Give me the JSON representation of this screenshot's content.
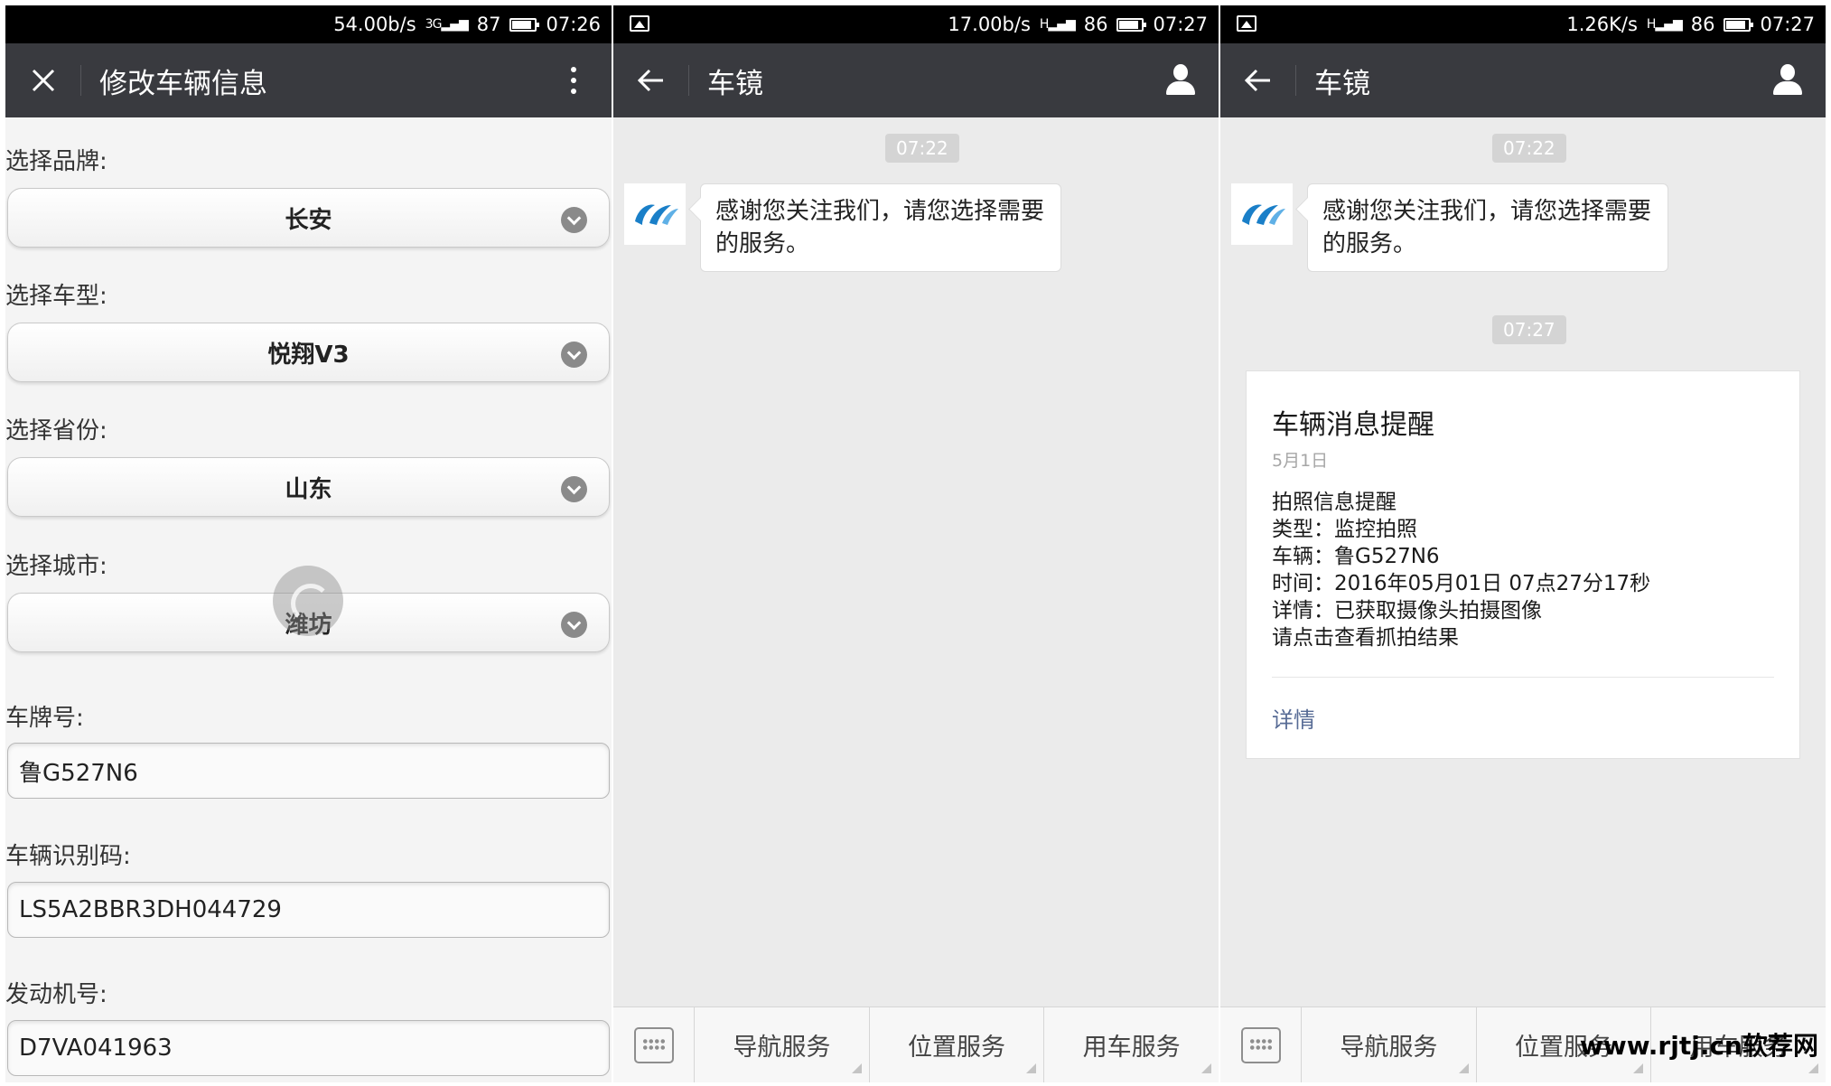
{
  "panel1": {
    "status": {
      "speed": "54.00b/s",
      "network": "3G",
      "battery": "87",
      "time": "07:26"
    },
    "nav": {
      "title": "修改车辆信息"
    },
    "form": {
      "brand": {
        "label": "选择品牌:",
        "value": "长安"
      },
      "model": {
        "label": "选择车型:",
        "value": "悦翔V3"
      },
      "province": {
        "label": "选择省份:",
        "value": "山东"
      },
      "city": {
        "label": "选择城市:",
        "value": "潍坊"
      },
      "plate": {
        "label": "车牌号:",
        "value": "鲁G527N6"
      },
      "vin": {
        "label": "车辆识别码:",
        "value": "LS5A2BBR3DH044729"
      },
      "engine": {
        "label": "发动机号:",
        "value": "D7VA041963"
      }
    }
  },
  "panel2": {
    "status": {
      "speed": "17.00b/s",
      "network": "H",
      "battery": "86",
      "time": "07:27"
    },
    "nav": {
      "title": "车镜"
    },
    "chat": {
      "time1": "07:22",
      "message": "感谢您关注我们，请您选择需要的服务。"
    },
    "menu": [
      "导航服务",
      "位置服务",
      "用车服务"
    ]
  },
  "panel3": {
    "status": {
      "speed": "1.26K/s",
      "network": "H",
      "battery": "86",
      "time": "07:27"
    },
    "nav": {
      "title": "车镜"
    },
    "chat": {
      "time1": "07:22",
      "message": "感谢您关注我们，请您选择需要的服务。",
      "time2": "07:27"
    },
    "card": {
      "title": "车辆消息提醒",
      "date": "5月1日",
      "lines": [
        "拍照信息提醒",
        "类型：监控拍照",
        "车辆：鲁G527N6",
        "时间：2016年05月01日 07点27分17秒",
        "详情：已获取摄像头拍摄图像",
        "请点击查看抓拍结果"
      ],
      "link": "详情"
    },
    "menu": [
      "导航服务",
      "位置服务",
      "用车服务"
    ],
    "watermark": "www.rjtj.cn软荐网"
  },
  "icons": {
    "close": "close-icon",
    "more": "kebab-menu-icon",
    "back": "back-arrow-icon",
    "profile": "person-icon",
    "keyboard": "keyboard-icon",
    "dropdown": "chevron-down-icon",
    "loading": "loading-spinner-icon",
    "gallery": "gallery-icon",
    "logo": "brand-logo-icon"
  },
  "colors": {
    "navbar": "#393a3f",
    "statusbar": "#000000",
    "chat_bg": "#ebebeb",
    "link": "#576b95",
    "logo_blue": "#1a7fc8"
  }
}
